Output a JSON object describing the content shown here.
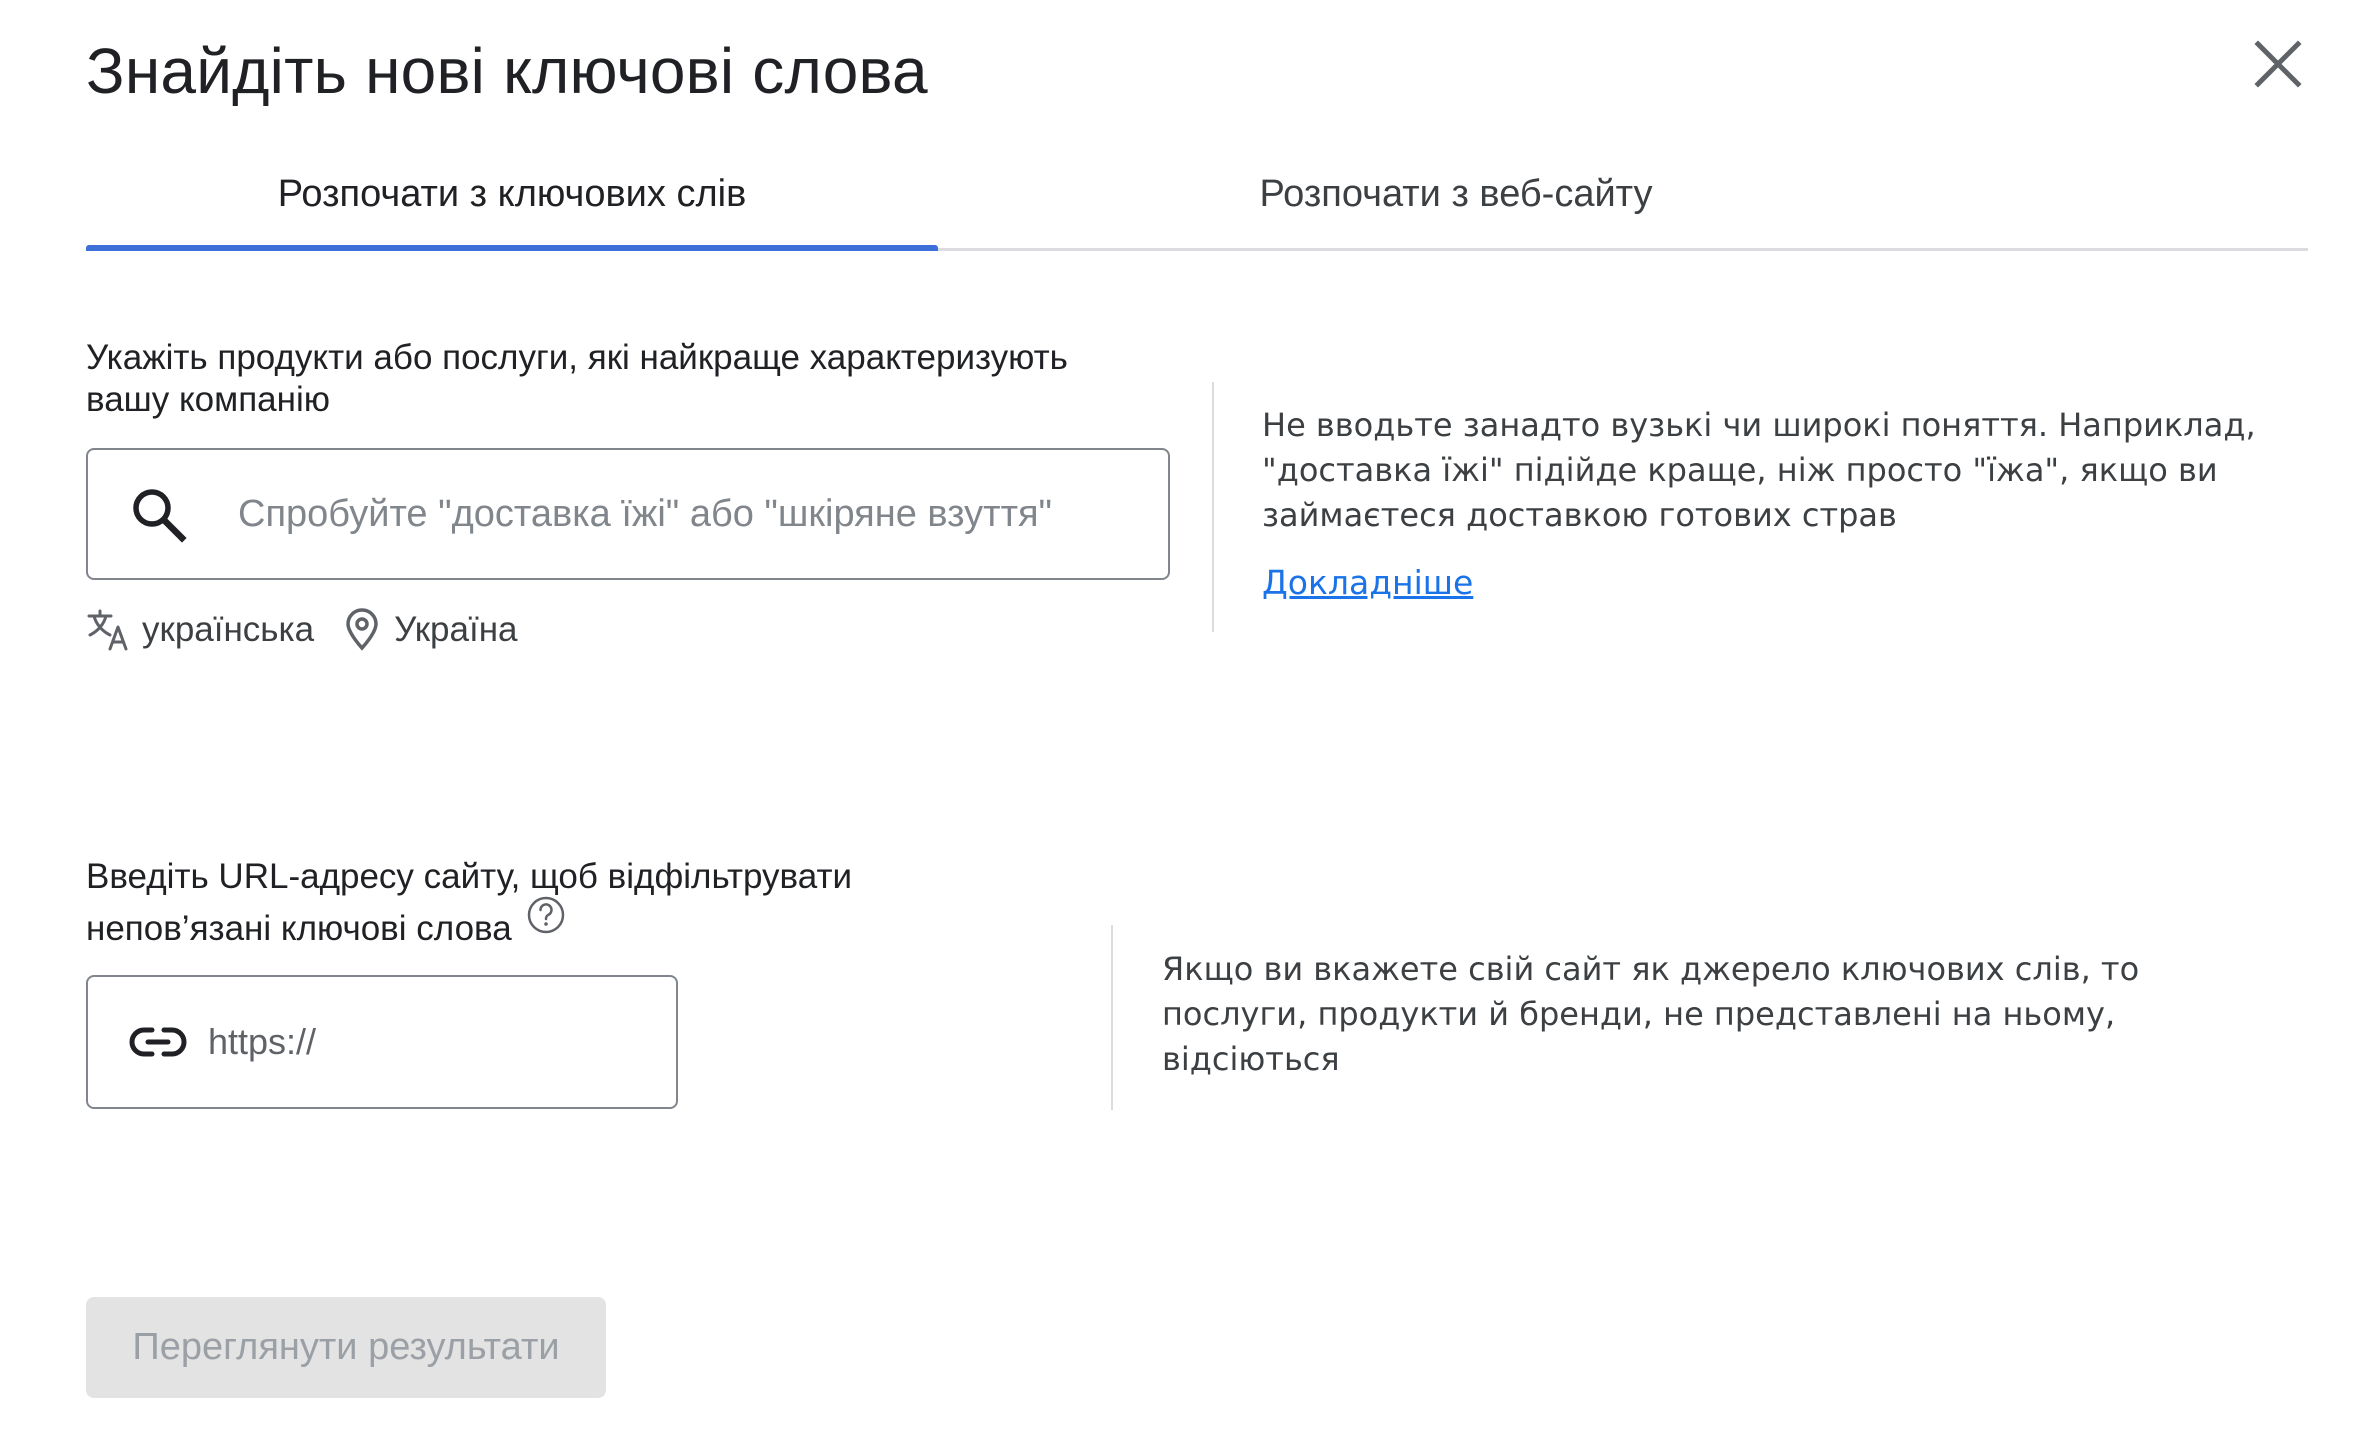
{
  "dialog": {
    "title": "Знайдіть нові ключові слова"
  },
  "tabs": [
    {
      "label": "Розпочати з ключових слів",
      "active": true
    },
    {
      "label": "Розпочати з веб-сайту",
      "active": false
    }
  ],
  "keywords_section": {
    "label_line1": "Укажіть продукти або послуги, які найкраще характеризують",
    "label_line2": "вашу компанію",
    "search_placeholder": "Спробуйте \"доставка їжі\" або \"шкіряне взуття\"",
    "search_value": "",
    "language": "українська",
    "location": "Україна",
    "hint_line1": "Не вводьте занадто вузькі чи широкі поняття. Наприклад,",
    "hint_line2": "\"доставка їжі\" підійде краще, ніж просто \"їжа\", якщо ви",
    "hint_line3": "займаєтеся доставкою готових страв",
    "learn_more": "Докладніше"
  },
  "url_section": {
    "label_line1": "Введіть URL-адресу сайту, щоб відфільтрувати",
    "label_line2": "непов’язані ключові слова",
    "url_placeholder": "https://",
    "url_value": "",
    "hint_line1": "Якщо ви вкажете свій сайт як джерело ключових слів, то",
    "hint_line2": "послуги, продукти й бренди, не представлені на ньому,",
    "hint_line3": "відсіються"
  },
  "actions": {
    "results_button": "Переглянути результати",
    "results_button_enabled": false
  },
  "icons": {
    "close": "close-icon",
    "search": "search-icon",
    "translate": "translate-icon",
    "location": "location-pin-icon",
    "help": "help-circle-icon",
    "link": "link-icon"
  },
  "colors": {
    "active_tab_indicator": "#3c6fd8",
    "link": "#1a73e8",
    "disabled_button_bg": "#e3e3e3",
    "disabled_button_text": "#9aa0a6"
  }
}
